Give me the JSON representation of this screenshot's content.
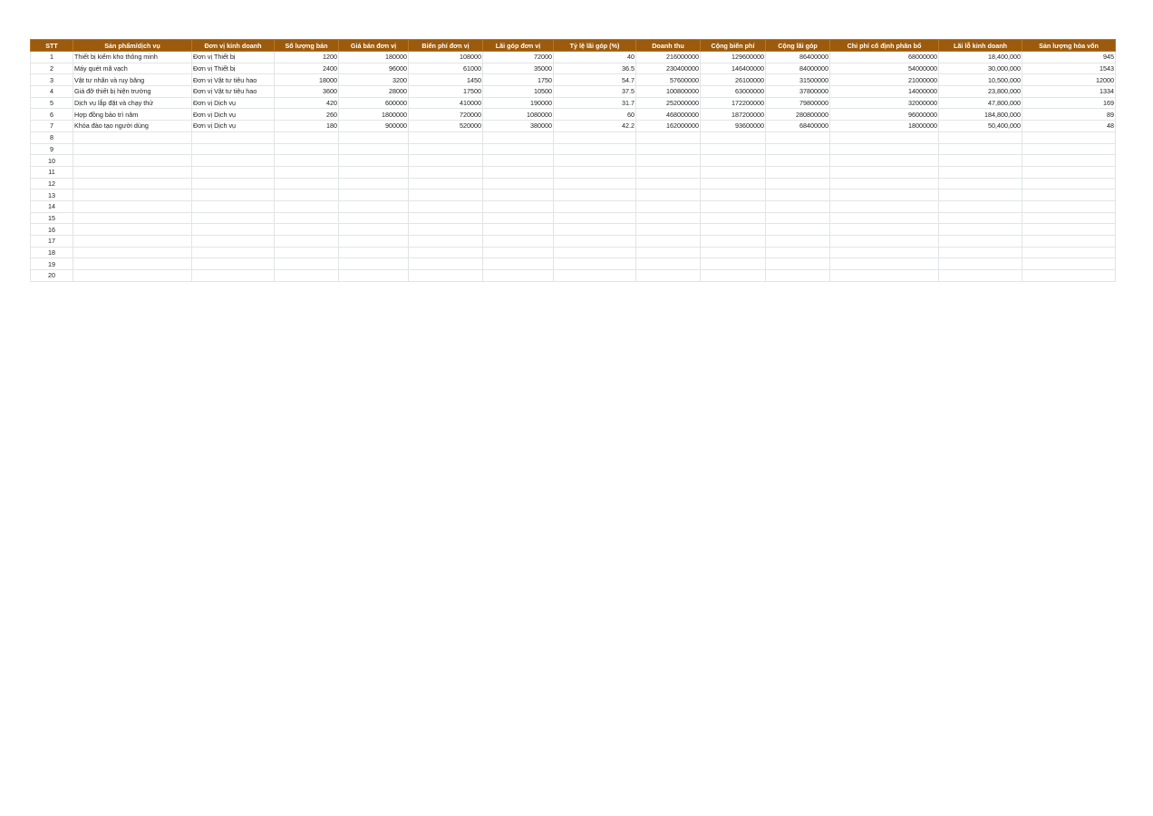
{
  "sheet": {
    "headers": [
      "STT",
      "Sản phẩm/dịch vụ",
      "Đơn vị kinh doanh",
      "Số lượng bán",
      "Giá bán đơn vị",
      "Biến phí đơn vị",
      "Lãi góp đơn vị",
      "Tỷ lệ lãi góp (%)",
      "Doanh thu",
      "Cộng biến phí",
      "Cộng lãi góp",
      "Chi phí cố định phân bổ",
      "Lãi lỗ kinh doanh",
      "Sản lượng hòa vốn"
    ],
    "rows": [
      [
        "1",
        "Thiết bị kiểm kho thông minh",
        "Đơn vị Thiết bị",
        "1200",
        "180000",
        "108000",
        "72000",
        "40",
        "216000000",
        "129600000",
        "86400000",
        "68000000",
        "18,400,000",
        "945"
      ],
      [
        "2",
        "Máy quét mã vạch",
        "Đơn vị Thiết bị",
        "2400",
        "96000",
        "61000",
        "35000",
        "36.5",
        "230400000",
        "146400000",
        "84000000",
        "54000000",
        "30,000,000",
        "1543"
      ],
      [
        "3",
        "Vật tư nhãn và ruy băng",
        "Đơn vị Vật tư tiêu hao",
        "18000",
        "3200",
        "1450",
        "1750",
        "54.7",
        "57600000",
        "26100000",
        "31500000",
        "21000000",
        "10,500,000",
        "12000"
      ],
      [
        "4",
        "Giá đỡ thiết bị hiện trường",
        "Đơn vị Vật tư tiêu hao",
        "3600",
        "28000",
        "17500",
        "10500",
        "37.5",
        "100800000",
        "63000000",
        "37800000",
        "14000000",
        "23,800,000",
        "1334"
      ],
      [
        "5",
        "Dịch vụ lắp đặt và chạy thử",
        "Đơn vị Dịch vụ",
        "420",
        "600000",
        "410000",
        "190000",
        "31.7",
        "252000000",
        "172200000",
        "79800000",
        "32000000",
        "47,800,000",
        "169"
      ],
      [
        "6",
        "Hợp đồng bảo trì năm",
        "Đơn vị Dịch vụ",
        "260",
        "1800000",
        "720000",
        "1080000",
        "60",
        "468000000",
        "187200000",
        "280800000",
        "96000000",
        "184,800,000",
        "89"
      ],
      [
        "7",
        "Khóa đào tạo người dùng",
        "Đơn vị Dịch vụ",
        "180",
        "900000",
        "520000",
        "380000",
        "42.2",
        "162000000",
        "93600000",
        "68400000",
        "18000000",
        "50,400,000",
        "48"
      ],
      [
        "8",
        "",
        "",
        "",
        "",
        "",
        "",
        "",
        "",
        "",
        "",
        "",
        "",
        ""
      ],
      [
        "9",
        "",
        "",
        "",
        "",
        "",
        "",
        "",
        "",
        "",
        "",
        "",
        "",
        ""
      ],
      [
        "10",
        "",
        "",
        "",
        "",
        "",
        "",
        "",
        "",
        "",
        "",
        "",
        "",
        ""
      ],
      [
        "11",
        "",
        "",
        "",
        "",
        "",
        "",
        "",
        "",
        "",
        "",
        "",
        "",
        ""
      ],
      [
        "12",
        "",
        "",
        "",
        "",
        "",
        "",
        "",
        "",
        "",
        "",
        "",
        "",
        ""
      ],
      [
        "13",
        "",
        "",
        "",
        "",
        "",
        "",
        "",
        "",
        "",
        "",
        "",
        "",
        ""
      ],
      [
        "14",
        "",
        "",
        "",
        "",
        "",
        "",
        "",
        "",
        "",
        "",
        "",
        "",
        ""
      ],
      [
        "15",
        "",
        "",
        "",
        "",
        "",
        "",
        "",
        "",
        "",
        "",
        "",
        "",
        ""
      ],
      [
        "16",
        "",
        "",
        "",
        "",
        "",
        "",
        "",
        "",
        "",
        "",
        "",
        "",
        ""
      ],
      [
        "17",
        "",
        "",
        "",
        "",
        "",
        "",
        "",
        "",
        "",
        "",
        "",
        "",
        ""
      ],
      [
        "18",
        "",
        "",
        "",
        "",
        "",
        "",
        "",
        "",
        "",
        "",
        "",
        "",
        ""
      ],
      [
        "19",
        "",
        "",
        "",
        "",
        "",
        "",
        "",
        "",
        "",
        "",
        "",
        "",
        ""
      ],
      [
        "20",
        "",
        "",
        "",
        "",
        "",
        "",
        "",
        "",
        "",
        "",
        "",
        "",
        ""
      ]
    ]
  },
  "colors": {
    "header_bg": "#9c5b0c",
    "header_text": "#ffffff",
    "grid": "#e1e4e8"
  }
}
